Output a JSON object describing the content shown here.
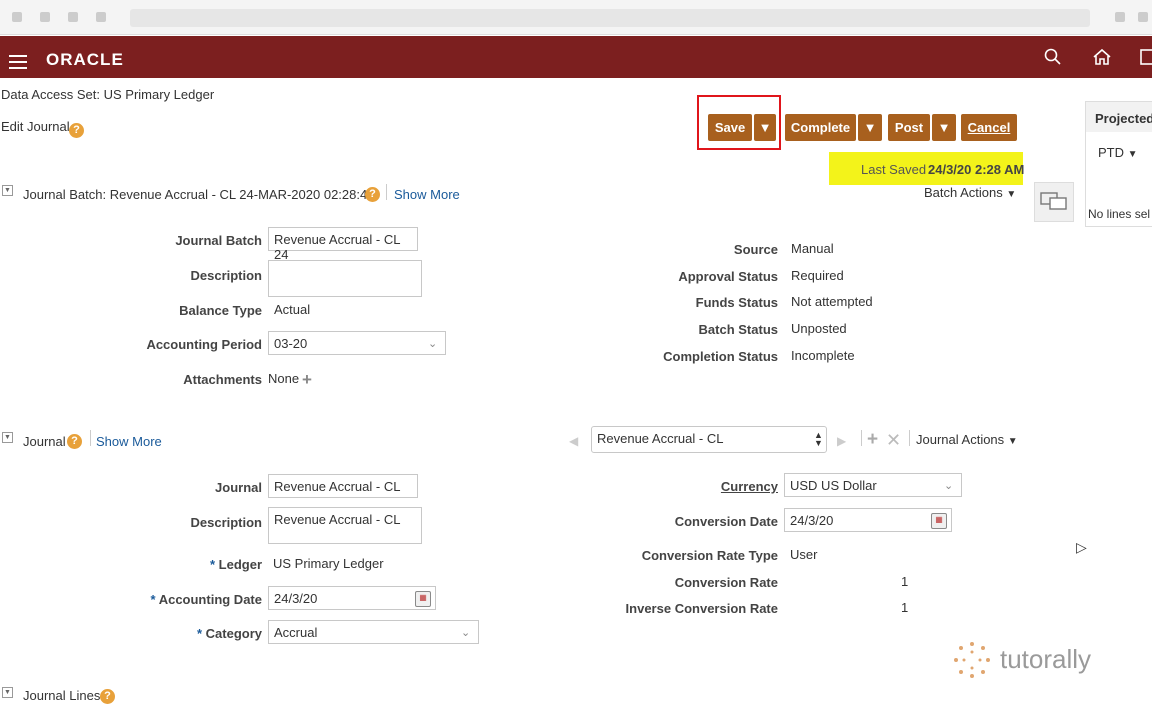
{
  "header": {
    "brand": "ORACLE"
  },
  "top": {
    "data_access_label": "Data Access Set:",
    "data_access_value": "US Primary Ledger",
    "page_title": "Edit Journal"
  },
  "toolbar": {
    "save": "Save",
    "complete": "Complete",
    "post": "Post",
    "cancel": "Cancel",
    "last_saved_label": "Last Saved",
    "last_saved_value": "24/3/20 2:28 AM",
    "batch_actions": "Batch Actions"
  },
  "side_panel": {
    "title": "Projected",
    "ptd": "PTD",
    "no_lines": "No lines sel"
  },
  "batch": {
    "header": "Journal Batch: Revenue Accrual - CL 24-MAR-2020 02:28:40",
    "show_more": "Show More",
    "journal_batch_label": "Journal Batch",
    "journal_batch_value": "Revenue Accrual - CL 24",
    "description_label": "Description",
    "description_value": "",
    "balance_type_label": "Balance Type",
    "balance_type_value": "Actual",
    "accounting_period_label": "Accounting Period",
    "accounting_period_value": "03-20",
    "attachments_label": "Attachments",
    "attachments_value": "None",
    "source_label": "Source",
    "source_value": "Manual",
    "approval_status_label": "Approval Status",
    "approval_status_value": "Required",
    "funds_status_label": "Funds Status",
    "funds_status_value": "Not attempted",
    "batch_status_label": "Batch Status",
    "batch_status_value": "Unposted",
    "completion_status_label": "Completion Status",
    "completion_status_value": "Incomplete"
  },
  "journal": {
    "header": "Journal",
    "show_more": "Show More",
    "selector_value": "Revenue Accrual - CL",
    "journal_actions": "Journal Actions",
    "journal_label": "Journal",
    "journal_value": "Revenue Accrual - CL",
    "description_label": "Description",
    "description_value": "Revenue Accrual - CL",
    "ledger_label": "Ledger",
    "ledger_value": "US Primary Ledger",
    "accounting_date_label": "Accounting Date",
    "accounting_date_value": "24/3/20",
    "category_label": "Category",
    "category_value": "Accrual",
    "currency_label": "Currency",
    "currency_value": "USD US Dollar",
    "conversion_date_label": "Conversion Date",
    "conversion_date_value": "24/3/20",
    "conversion_rate_type_label": "Conversion Rate Type",
    "conversion_rate_type_value": "User",
    "conversion_rate_label": "Conversion Rate",
    "conversion_rate_value": "1",
    "inverse_conversion_rate_label": "Inverse Conversion Rate",
    "inverse_conversion_rate_value": "1"
  },
  "journal_lines": {
    "header": "Journal Lines"
  },
  "watermark": {
    "text": "tutorally"
  },
  "colors": {
    "header_bg": "#7c1f1f",
    "button_bg": "#a8601e",
    "highlight": "#f3f31a",
    "link": "#1a5a9a"
  }
}
